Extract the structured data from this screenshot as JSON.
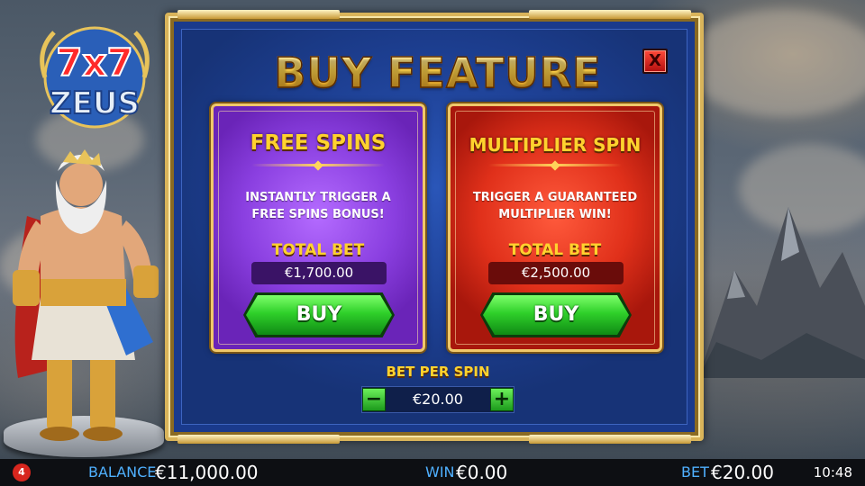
{
  "game": {
    "logo_top": "7x7",
    "logo_bottom": "ZEUS"
  },
  "dialog": {
    "title": "BUY FEATURE",
    "close_label": "X",
    "options": [
      {
        "title": "FREE SPINS",
        "description_line1": "INSTANTLY TRIGGER A",
        "description_line2": "FREE SPINS BONUS!",
        "total_bet_label": "TOTAL BET",
        "total_bet_value": "€1,700.00",
        "buy_label": "BUY",
        "color": "#8a3fe0"
      },
      {
        "title": "MULTIPLIER SPIN",
        "description_line1": "TRIGGER A GUARANTEED",
        "description_line2": "MULTIPLIER WIN!",
        "total_bet_label": "TOTAL BET",
        "total_bet_value": "€2,500.00",
        "buy_label": "BUY",
        "color": "#e0301a"
      }
    ],
    "bet_per_spin": {
      "label": "BET PER SPIN",
      "value": "€20.00",
      "minus_label": "−",
      "plus_label": "+"
    }
  },
  "bottom_bar": {
    "provider_badge": "4",
    "balance_label": "BALANCE",
    "balance_value": "€11,000.00",
    "win_label": "WIN",
    "win_value": "€0.00",
    "bet_label": "BET",
    "bet_value": "€20.00",
    "clock": "10:48"
  },
  "colors": {
    "accent_gold": "#ffd22e",
    "panel_blue": "#1d3f92",
    "buy_green": "#2fd02a",
    "label_blue": "#4fb0ff"
  }
}
